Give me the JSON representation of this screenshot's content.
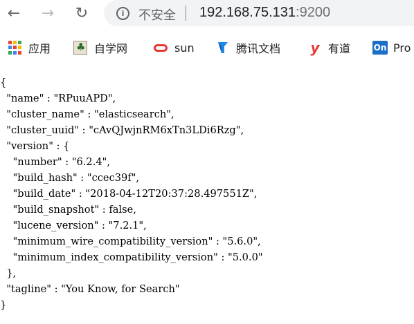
{
  "browser": {
    "security_label": "不安全",
    "url_host": "192.168.75.131",
    "url_port": ":9200"
  },
  "bookmarks": [
    {
      "label": "应用",
      "icon": "apps-grid-icon"
    },
    {
      "label": "自学网",
      "icon": "zixue-icon"
    },
    {
      "label": "sun",
      "icon": "red-ring-icon"
    },
    {
      "label": "腾讯文档",
      "icon": "tencent-docs-icon"
    },
    {
      "label": "有道",
      "icon": "youdao-icon"
    },
    {
      "label": "Pro",
      "icon": "on-icon",
      "icon_text": "On"
    }
  ],
  "colors": {
    "apps_grid": [
      "#ea4335",
      "#fbbc05",
      "#34a853",
      "#4285f4",
      "#ea4335",
      "#fbbc05",
      "#34a853",
      "#4285f4",
      "#ea4335"
    ],
    "tencent_blue": "#1e88e5",
    "youdao_red": "#e53935"
  },
  "json_lines": [
    "{",
    "  \"name\" : \"RPuuAPD\",",
    "  \"cluster_name\" : \"elasticsearch\",",
    "  \"cluster_uuid\" : \"cAvQJwjnRM6xTn3LDi6Rzg\",",
    "  \"version\" : {",
    "    \"number\" : \"6.2.4\",",
    "    \"build_hash\" : \"ccec39f\",",
    "    \"build_date\" : \"2018-04-12T20:37:28.497551Z\",",
    "    \"build_snapshot\" : false,",
    "    \"lucene_version\" : \"7.2.1\",",
    "    \"minimum_wire_compatibility_version\" : \"5.6.0\",",
    "    \"minimum_index_compatibility_version\" : \"5.0.0\"",
    "  },",
    "  \"tagline\" : \"You Know, for Search\"",
    "}"
  ]
}
